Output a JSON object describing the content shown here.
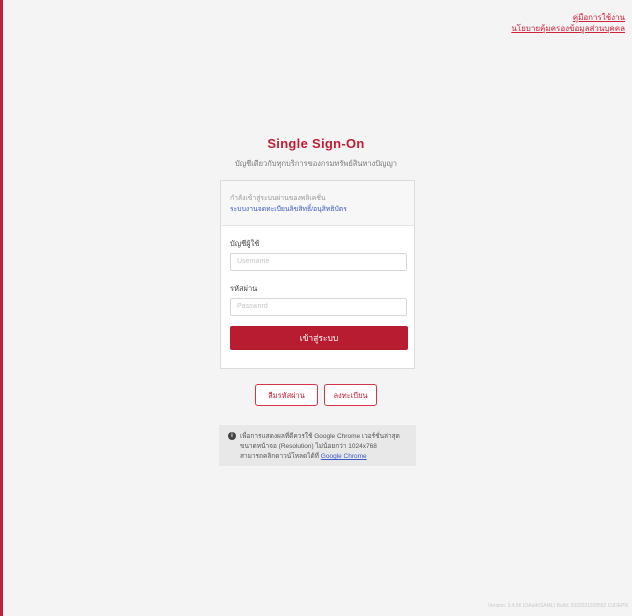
{
  "top_links": {
    "manual": "คู่มือการใช้งาน",
    "privacy": "นโยบายคุ้มครองข้อมูลส่วนบุคคล"
  },
  "header": {
    "title": "Single Sign-On",
    "subtitle": "บัญชีเดียวกับทุกบริการของกรมทรัพย์สินทางปัญญา"
  },
  "login": {
    "note": "กำลังเข้าสู่ระบบผ่านของพลิเคชั่น",
    "app_link": "ระบบงานจดทะเบียนลิขสิทธิ์/อนุสิทธิบัตร",
    "username_label": "บัญชีผู้ใช้",
    "username_placeholder": "Username",
    "password_label": "รหัสผ่าน",
    "password_placeholder": "Password",
    "submit_label": "เข้าสู่ระบบ"
  },
  "actions": {
    "forgot_label": "ลืมรหัสผ่าน",
    "register_label": "ลงทะเบียน"
  },
  "notice": {
    "icon": "info-icon",
    "line1": "เพื่อการแสดงผลที่ดีควรใช้ Google Chrome เวอร์ชั่นล่าสุด",
    "line2": "ขนาดหน้าจอ (Resolution) ไม่น้อยกว่า 1024x768",
    "line3_prefix": "สามารถคลิกดาวน์โหลดได้ที่ ",
    "line3_link": "Google Chrome"
  },
  "footer": {
    "version": "Version: 3.4.56 (OAuth/SAML) Build: 2022021108552 OJDEPN"
  },
  "colors": {
    "brand": "#b71c30",
    "link": "#3b59c7",
    "background": "#f4f4f4"
  }
}
